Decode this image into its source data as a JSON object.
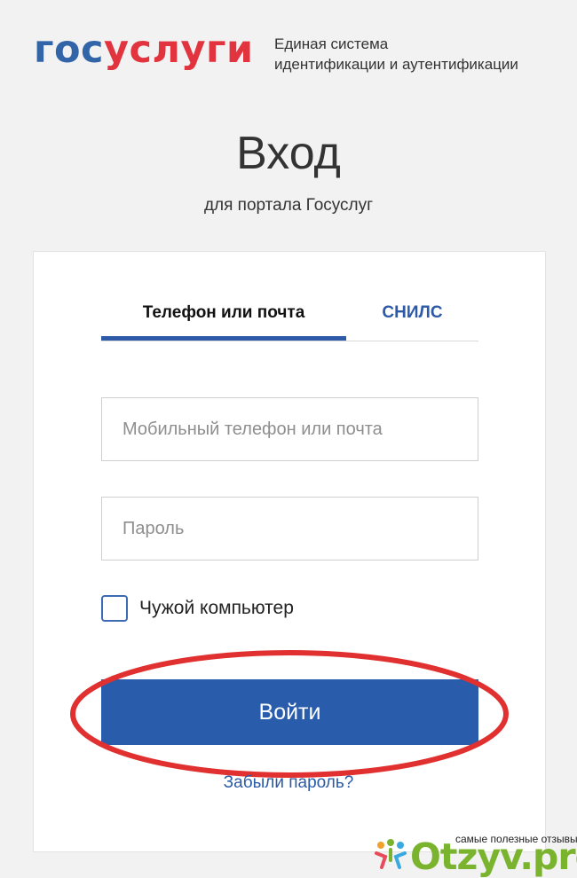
{
  "header": {
    "logo_part1": "гос",
    "logo_part2": "услуги",
    "subtitle_line1": "Единая система",
    "subtitle_line2": "идентификации и аутентификации"
  },
  "page": {
    "title": "Вход",
    "subtitle": "для портала Госуслуг"
  },
  "tabs": [
    {
      "label": "Телефон или почта",
      "active": true
    },
    {
      "label": "СНИЛС",
      "active": false
    }
  ],
  "form": {
    "login_placeholder": "Мобильный телефон или почта",
    "login_value": "",
    "password_placeholder": "Пароль",
    "password_value": "",
    "checkbox_label": "Чужой компьютер",
    "checkbox_checked": false,
    "submit_label": "Войти",
    "forgot_label": "Забыли пароль?"
  },
  "watermark": {
    "caption": "самые полезные отзывы",
    "site": "Otzyv.pro"
  },
  "colors": {
    "brand_blue": "#2a5cac",
    "brand_red": "#e2343e",
    "highlight_red": "#e0302f",
    "watermark_green": "#7ab32e"
  }
}
